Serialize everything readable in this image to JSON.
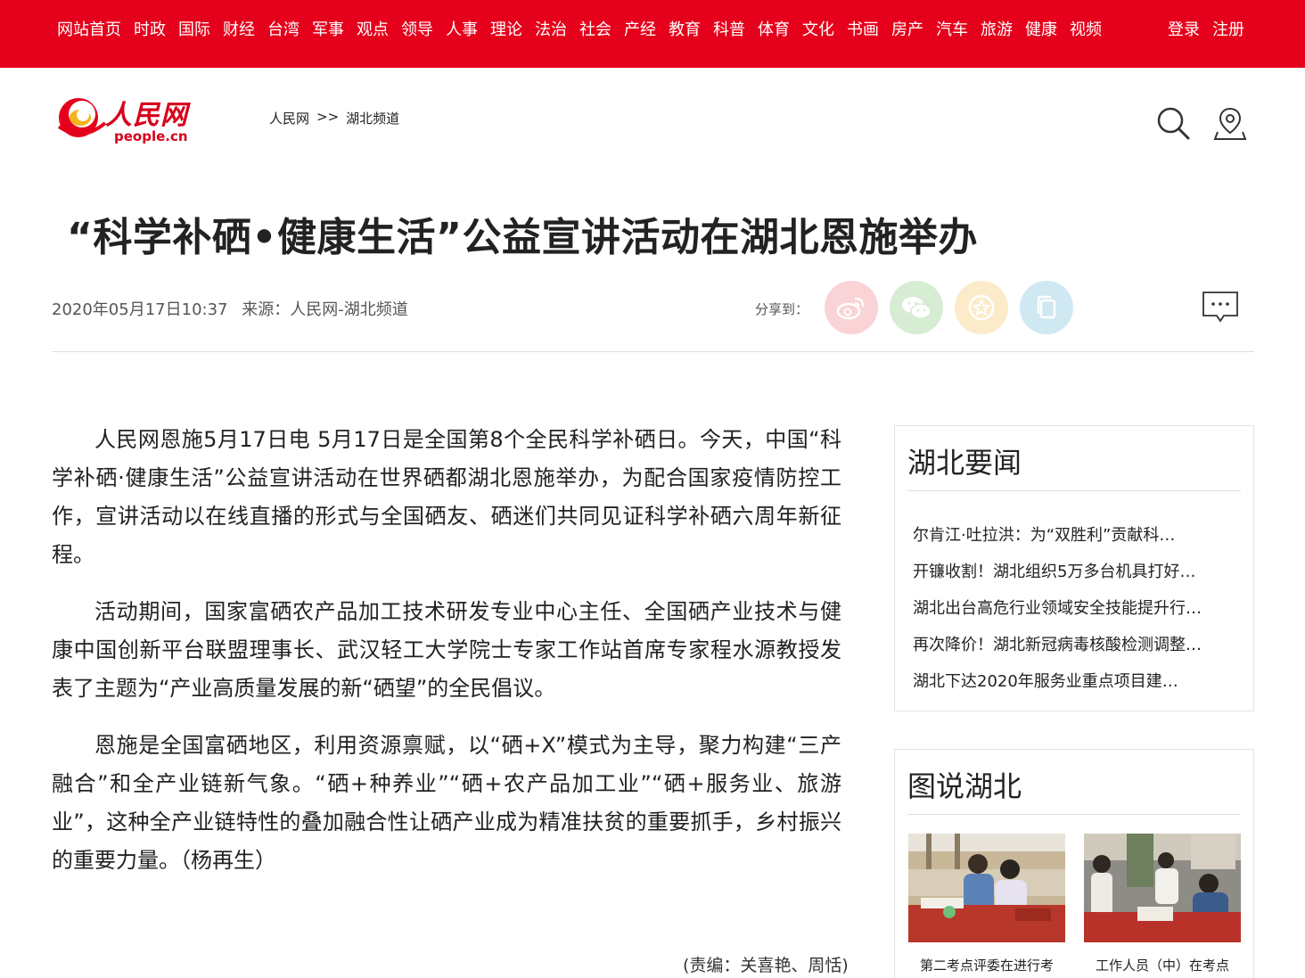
{
  "topnav": {
    "links": [
      "网站首页",
      "时政",
      "国际",
      "财经",
      "台湾",
      "军事",
      "观点",
      "领导",
      "人事",
      "理论",
      "法治",
      "社会",
      "产经",
      "教育",
      "科普",
      "体育",
      "文化",
      "书画",
      "房产",
      "汽车",
      "旅游",
      "健康",
      "视频"
    ],
    "login": "登录",
    "register": "注册",
    "bg_color": "#e5001b"
  },
  "logo": {
    "cn": "人民网",
    "en": "people.cn"
  },
  "breadcrumb": {
    "home": "人民网",
    "sep": ">>",
    "channel": "湖北频道"
  },
  "icons": {
    "search": "search-icon",
    "location": "location-pin-icon",
    "comment": "comment-icon"
  },
  "article": {
    "title": "“科学补硒•健康生活”公益宣讲活动在湖北恩施举办",
    "datetime": "2020年05月17日10:37",
    "source": "来源：人民网-湖北频道",
    "share_label": "分享到：",
    "paragraphs": [
      "人民网恩施5月17日电 5月17日是全国第8个全民科学补硒日。今天，中国“科学补硒·健康生活”公益宣讲活动在世界硒都湖北恩施举办，为配合国家疫情防控工作，宣讲活动以在线直播的形式与全国硒友、硒迷们共同见证科学补硒六周年新征程。",
      "活动期间，国家富硒农产品加工技术研发专业中心主任、全国硒产业技术与健康中国创新平台联盟理事长、武汉轻工大学院士专家工作站首席专家程水源教授发表了主题为“产业高质量发展的新“硒望”的全民倡议。",
      "恩施是全国富硒地区，利用资源禀赋，以“硒+X”模式为主导，聚力构建“三产融合”和全产业链新气象。“硒+种养业”“硒+农产品加工业”“硒+服务业、旅游业”，这种全产业链特性的叠加融合性让硒产业成为精准扶贫的重要抓手，乡村振兴的重要力量。（杨再生）"
    ],
    "editor": "(责编：关喜艳、周恬)"
  },
  "sidebar": {
    "news": {
      "title": "湖北要闻",
      "items": [
        "尔肯江·吐拉洪：为“双胜利”贡献科…",
        "开镰收割！湖北组织5万多台机具打好…",
        "湖北出台高危行业领域安全技能提升行…",
        "再次降价！湖北新冠病毒核酸检测调整…",
        "湖北下达2020年服务业重点项目建…"
      ]
    },
    "pics": {
      "title": "图说湖北",
      "items": [
        {
          "caption": "第二考点评委在进行考"
        },
        {
          "caption": "工作人员（中）在考点"
        }
      ]
    }
  }
}
